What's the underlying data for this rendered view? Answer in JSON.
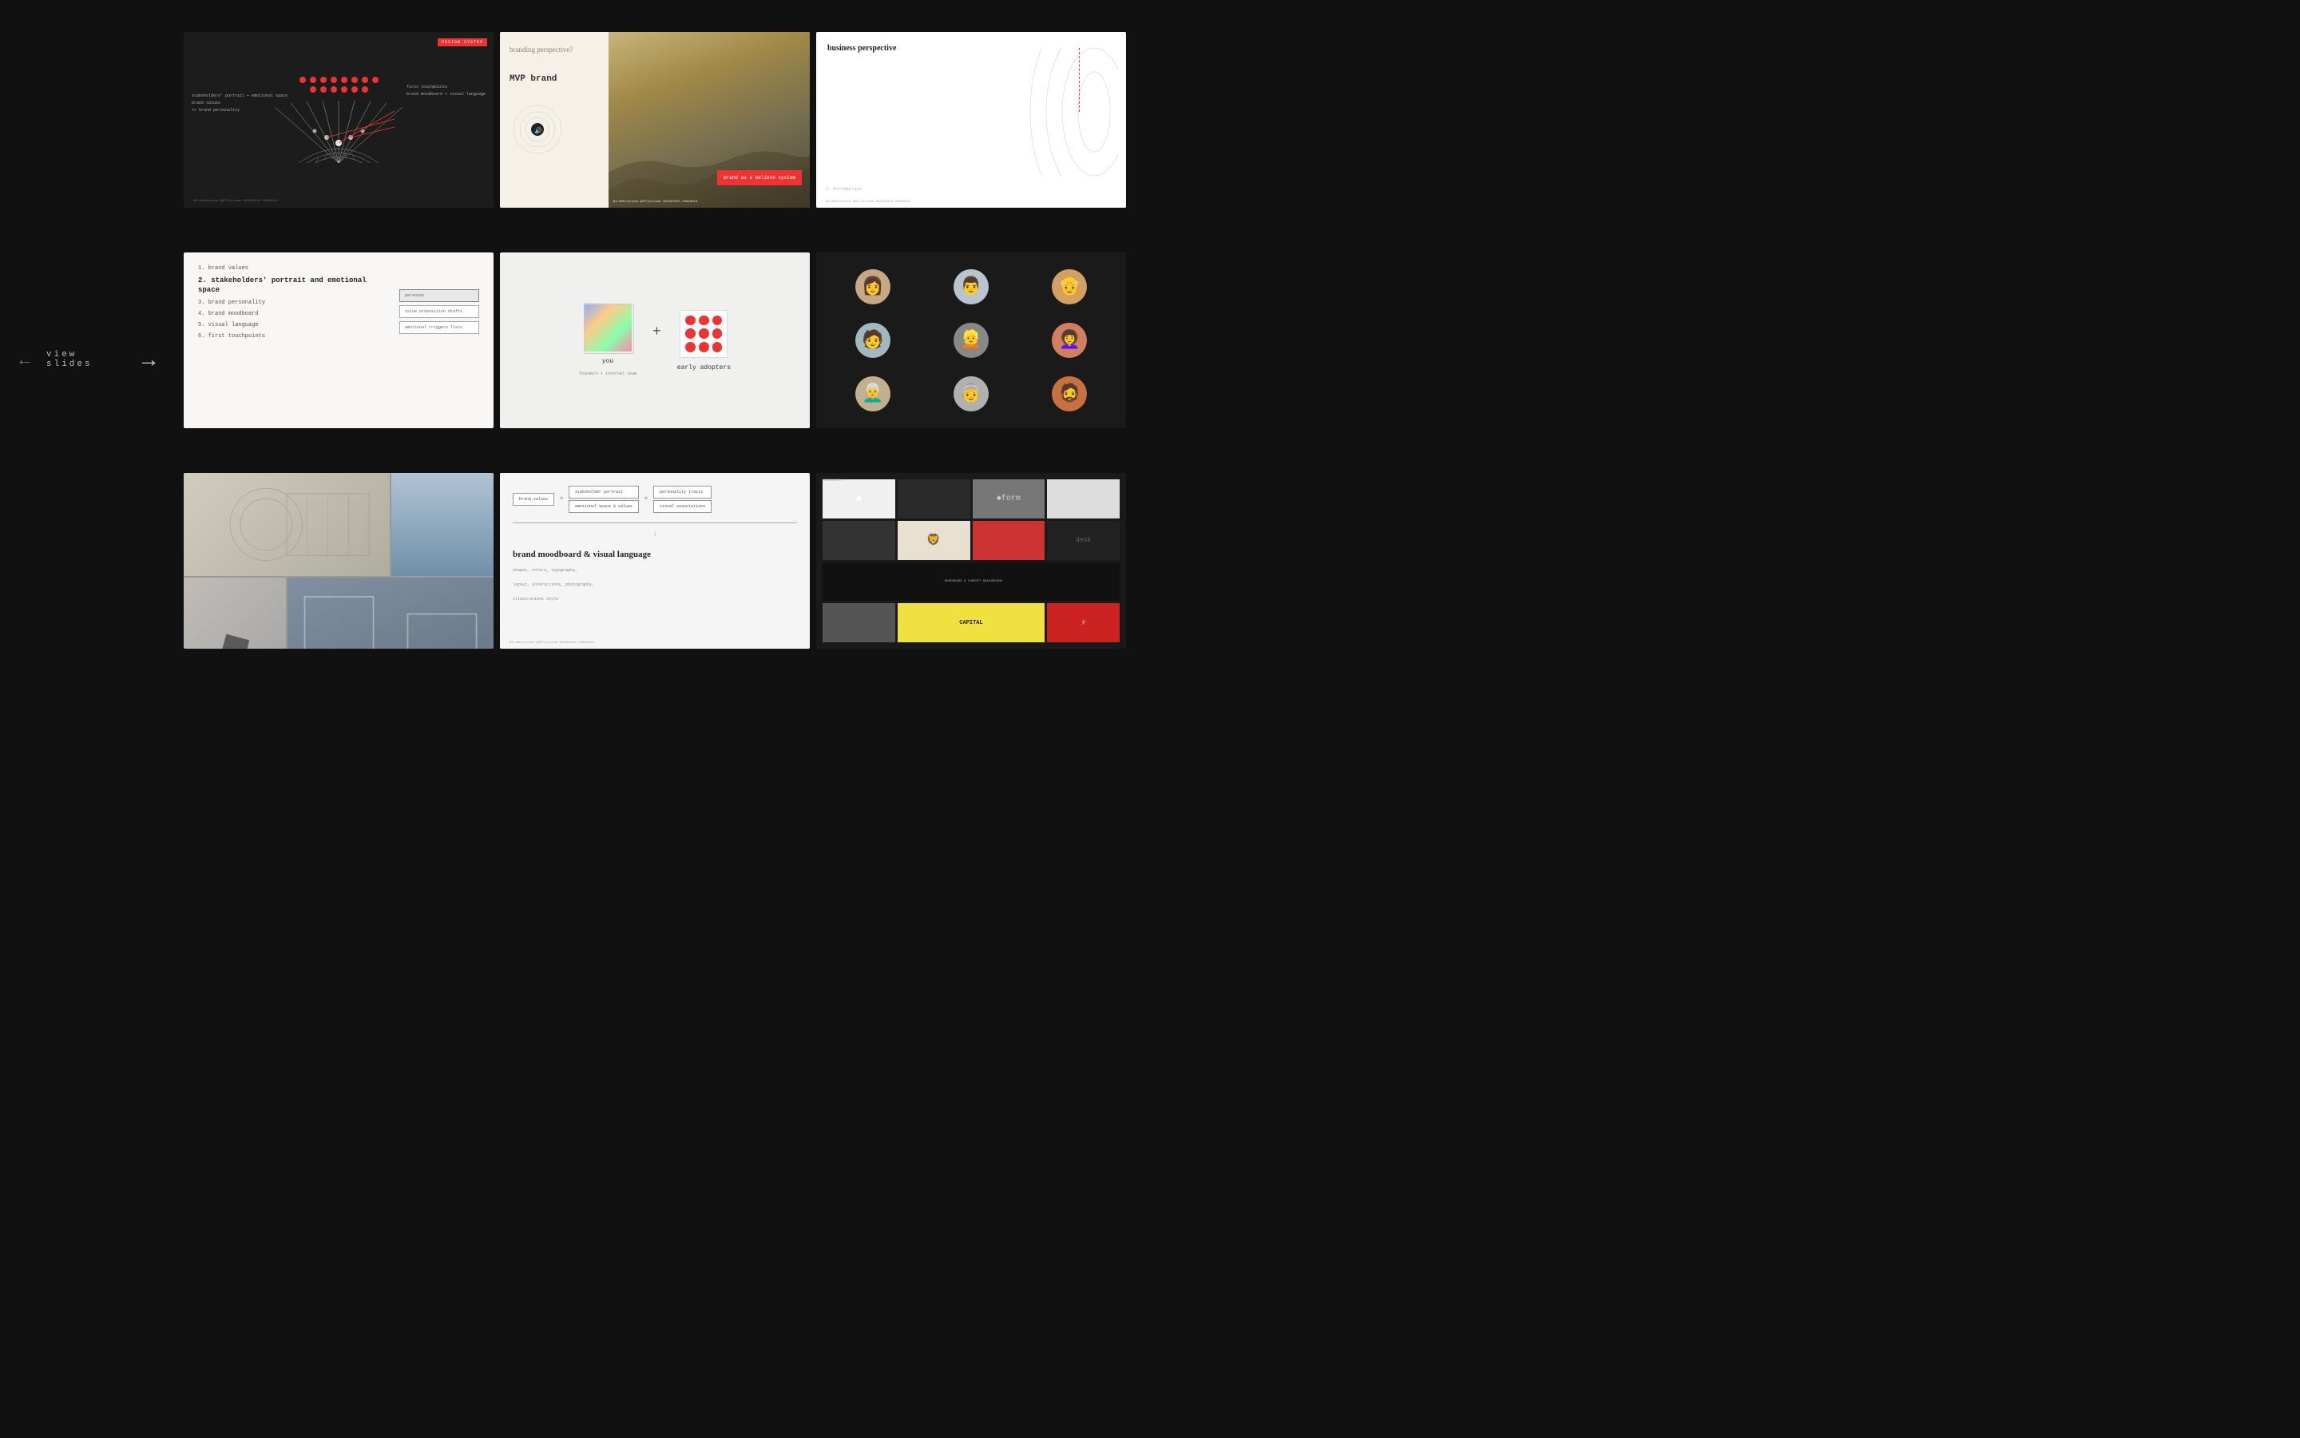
{
  "nav": {
    "back_arrow": "←",
    "forward_arrow": "→",
    "view_slides_label": "view slides"
  },
  "slides": [
    {
      "id": "slide-1",
      "type": "design-system",
      "badge": "DESIGN SYSTEM",
      "labels": [
        "first touchpoints",
        "brand moodboard + visual language",
        "stakeholders' portrait + emotional space",
        "brand values",
        ">> brand personality"
      ],
      "footer": "@IraMechynska @GETjoLocam #WIAD2020 #DWebBLN"
    },
    {
      "id": "slide-2",
      "type": "branding-perspective",
      "title": "branding perspective?",
      "mvp_brand": "MVP brand",
      "brand_believe": "brand as a believe system",
      "footer": "@IraMechynska @GETjoLocam #WIAD2020 #DWebBLN"
    },
    {
      "id": "slide-3",
      "type": "business-perspective",
      "title": "business perspective",
      "section_label": "I: Introduction",
      "footer": "@IraMechynska @GETjoLocam #WIAD2020 #DWebBLN"
    },
    {
      "id": "slide-4",
      "type": "brand-values-list",
      "items": [
        "1. brand values",
        "2. stakeholders' portrait and emotional space",
        "3. brand personality",
        "4. brand moodboard",
        "5. visual language",
        "6. first touchpoints"
      ],
      "boxes": [
        "personas",
        "value proposition drafts",
        "emotional triggers lists"
      ]
    },
    {
      "id": "slide-5",
      "type": "you-early-adopters",
      "you_label": "you",
      "you_sublabel": "founders + internal team",
      "early_label": "early adopters",
      "plus_sign": "+"
    },
    {
      "id": "slide-6",
      "type": "people-portraits",
      "people_count": 9
    },
    {
      "id": "slide-7",
      "type": "moodboard-photos",
      "description": "Architecture and interior moodboard photos"
    },
    {
      "id": "slide-8",
      "type": "brand-moodboard-diagram",
      "boxes": [
        "brand values",
        "stakeholder portrait",
        "personality traits",
        "emotional space & values",
        "visual associations"
      ],
      "title": "brand moodboard & visual language",
      "subtitle_lines": [
        "shapes, colors, typography,",
        "layout, interactions, photography,",
        "illustrations style"
      ],
      "footer": "@IraMechynska @GETjoLocam #WIAD2020 #DWebBLN"
    },
    {
      "id": "slide-9",
      "type": "moodboard-collage",
      "label_1": "MOODBOARD 2",
      "label_2": "MOODBOARD & CONCEPT BACKGROUND",
      "capital_text": "CAPITAL"
    }
  ]
}
